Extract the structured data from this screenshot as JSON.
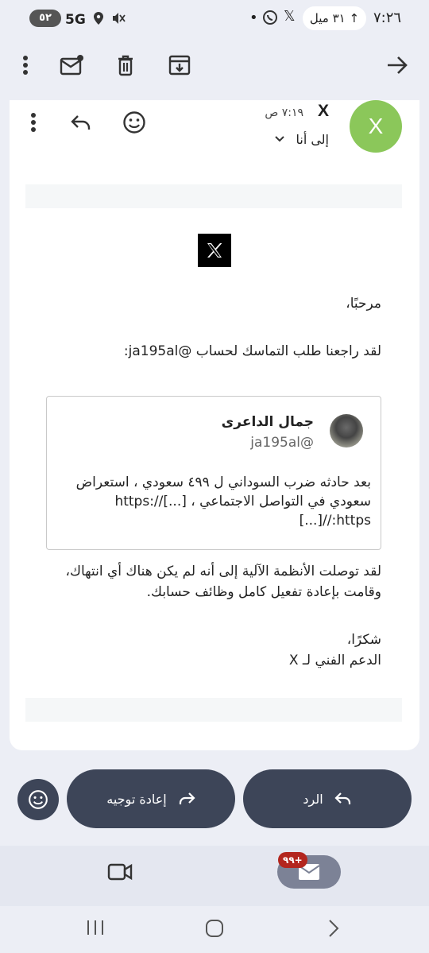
{
  "status_bar": {
    "time": "٧:٢٦",
    "notification_pill": "٣١ ميل",
    "network": "5G",
    "battery": "٥٢"
  },
  "toolbar": {
    "icons": [
      "back-arrow-icon",
      "archive-icon",
      "delete-icon",
      "mark-unread-icon",
      "more-vert-icon"
    ]
  },
  "message": {
    "avatar_letter": "X",
    "sender": "X",
    "time": "٧:١٩ ص",
    "to_label": "إلى أنا",
    "accent": "#8bc75a"
  },
  "email": {
    "logo_text": "𝕏",
    "greeting": "مرحبًا،",
    "review_line": "لقد راجعنا طلب التماسك لحساب @ja195al:",
    "tweet": {
      "name": "جمال الداعرى",
      "handle": "ja195al@",
      "body": "بعد حادثه ضرب السوداني ل ٤٩٩ سعودي ، استعراض سعودي في التواصل الاجتماعي ، [...]//:https [...]//:https"
    },
    "result": "لقد توصلت الأنظمة الآلية إلى أنه لم يكن هناك أي انتهاك، وقامت بإعادة تفعيل كامل وظائف حسابك.",
    "thanks": "شكرًا،",
    "signature": "الدعم الفني لـ X"
  },
  "actions": {
    "reply_label": "الرد",
    "forward_label": "إعادة توجيه"
  },
  "bottom_nav": {
    "mail_badge": "٩٩+"
  },
  "colors": {
    "pill": "#3d4558",
    "badge": "#b3261e"
  }
}
